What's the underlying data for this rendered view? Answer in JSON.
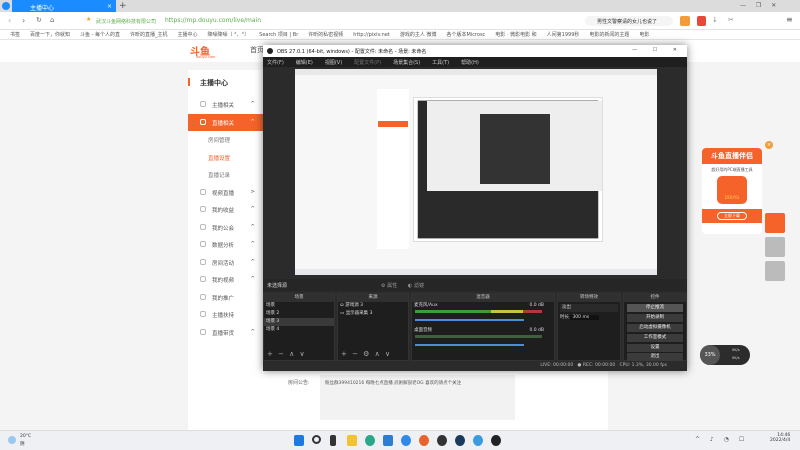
{
  "browser": {
    "tab_title": "主播中心",
    "new_tab": "+",
    "site_name": "武汉斗鱼网络科技有限公司",
    "url": "https://mp.douyu.com/live/main",
    "search_text": "男性文警察请的女儿也说了",
    "window_controls": [
      "—",
      "❐",
      "✕"
    ]
  },
  "bookmarks": [
    "书签",
    "百度一下，你就知",
    "斗鱼 - 每个人的直",
    "许昕的直播_主机",
    "主播中心",
    "降噪降噪（ °、°）",
    "Search 项目 | Br",
    "许昕的私密视频",
    "http://pixiv.net",
    "游戏的主人 微博",
    "各个版本Microsc",
    "电影 · 微影电影 和",
    "人间第1999秒",
    "电影的新闻的主题",
    "电影"
  ],
  "logo": {
    "text": "斗鱼",
    "sub": "douyu.com"
  },
  "nav_home": "首页",
  "sidebar": {
    "title": "主播中心",
    "items": [
      {
        "label": "主播相关",
        "expand": "^"
      },
      {
        "label": "直播相关",
        "expand": "^",
        "active": true
      },
      {
        "label": "房间管理",
        "sub": true
      },
      {
        "label": "直播设置",
        "sub": true,
        "highlight": true
      },
      {
        "label": "直播记录",
        "sub": true
      },
      {
        "label": "视频直播",
        "expand": ">"
      },
      {
        "label": "我的收益",
        "expand": "^"
      },
      {
        "label": "我的公会",
        "expand": "^"
      },
      {
        "label": "数据分析",
        "expand": "^"
      },
      {
        "label": "房间活动",
        "expand": "^"
      },
      {
        "label": "我的视频",
        "expand": "^"
      },
      {
        "label": "我的推广"
      },
      {
        "label": "主播扶持"
      },
      {
        "label": "直播带货",
        "expand": "^"
      }
    ]
  },
  "announcement": {
    "label": "房间公告:",
    "text": "粉丝群399410216 每晚七点直播 武術解說老OG 喜欢的请点个关注"
  },
  "obs": {
    "title": "OBS 27.0.1 (64-bit, windows) - 配置文件: 未命名 - 场景: 未命名",
    "menu": [
      "文件(F)",
      "编辑(E)",
      "视图(V)",
      "配置文件(P)",
      "场景集合(S)",
      "工具(T)",
      "帮助(H)"
    ],
    "no_source": "未选择源",
    "props": "属性",
    "filters": "滤镜",
    "scenes": {
      "header": "场景",
      "items": [
        "场景",
        "场景 2",
        "场景 3",
        "场景 4"
      ],
      "selected": 2
    },
    "sources": {
      "header": "来源",
      "items": [
        "游戏源 3",
        "显示器采集 3"
      ]
    },
    "mixer": {
      "header": "混音器",
      "channels": [
        {
          "name": "麦克风/Aux",
          "db": "0.0 dB"
        },
        {
          "name": "桌面音频",
          "db": "0.0 dB"
        }
      ]
    },
    "transitions": {
      "header": "转场特效",
      "type": "淡出",
      "duration_label": "时长",
      "duration": "300 ms"
    },
    "controls": {
      "header": "控件",
      "buttons": [
        "停止推流",
        "开始录制",
        "启动虚拟摄像机",
        "工作室模式",
        "设置",
        "退出"
      ]
    },
    "status": {
      "live": "LIVE: 00:00:00",
      "rec": "REC: 00:00:00",
      "cpu": "CPU: 1.3%, 30.00 fps"
    }
  },
  "promo": {
    "title": "斗鱼直播伴侣",
    "desc": "超好用的PC端直播工具",
    "app": "DOUYU",
    "button": "立即下载"
  },
  "net_widget": {
    "percent": "33%",
    "up": "0K/s",
    "down": "0K/s"
  },
  "taskbar": {
    "weather": "20°C",
    "weather_sub": "阴",
    "time": "14:46",
    "date": "2022/4/4"
  }
}
